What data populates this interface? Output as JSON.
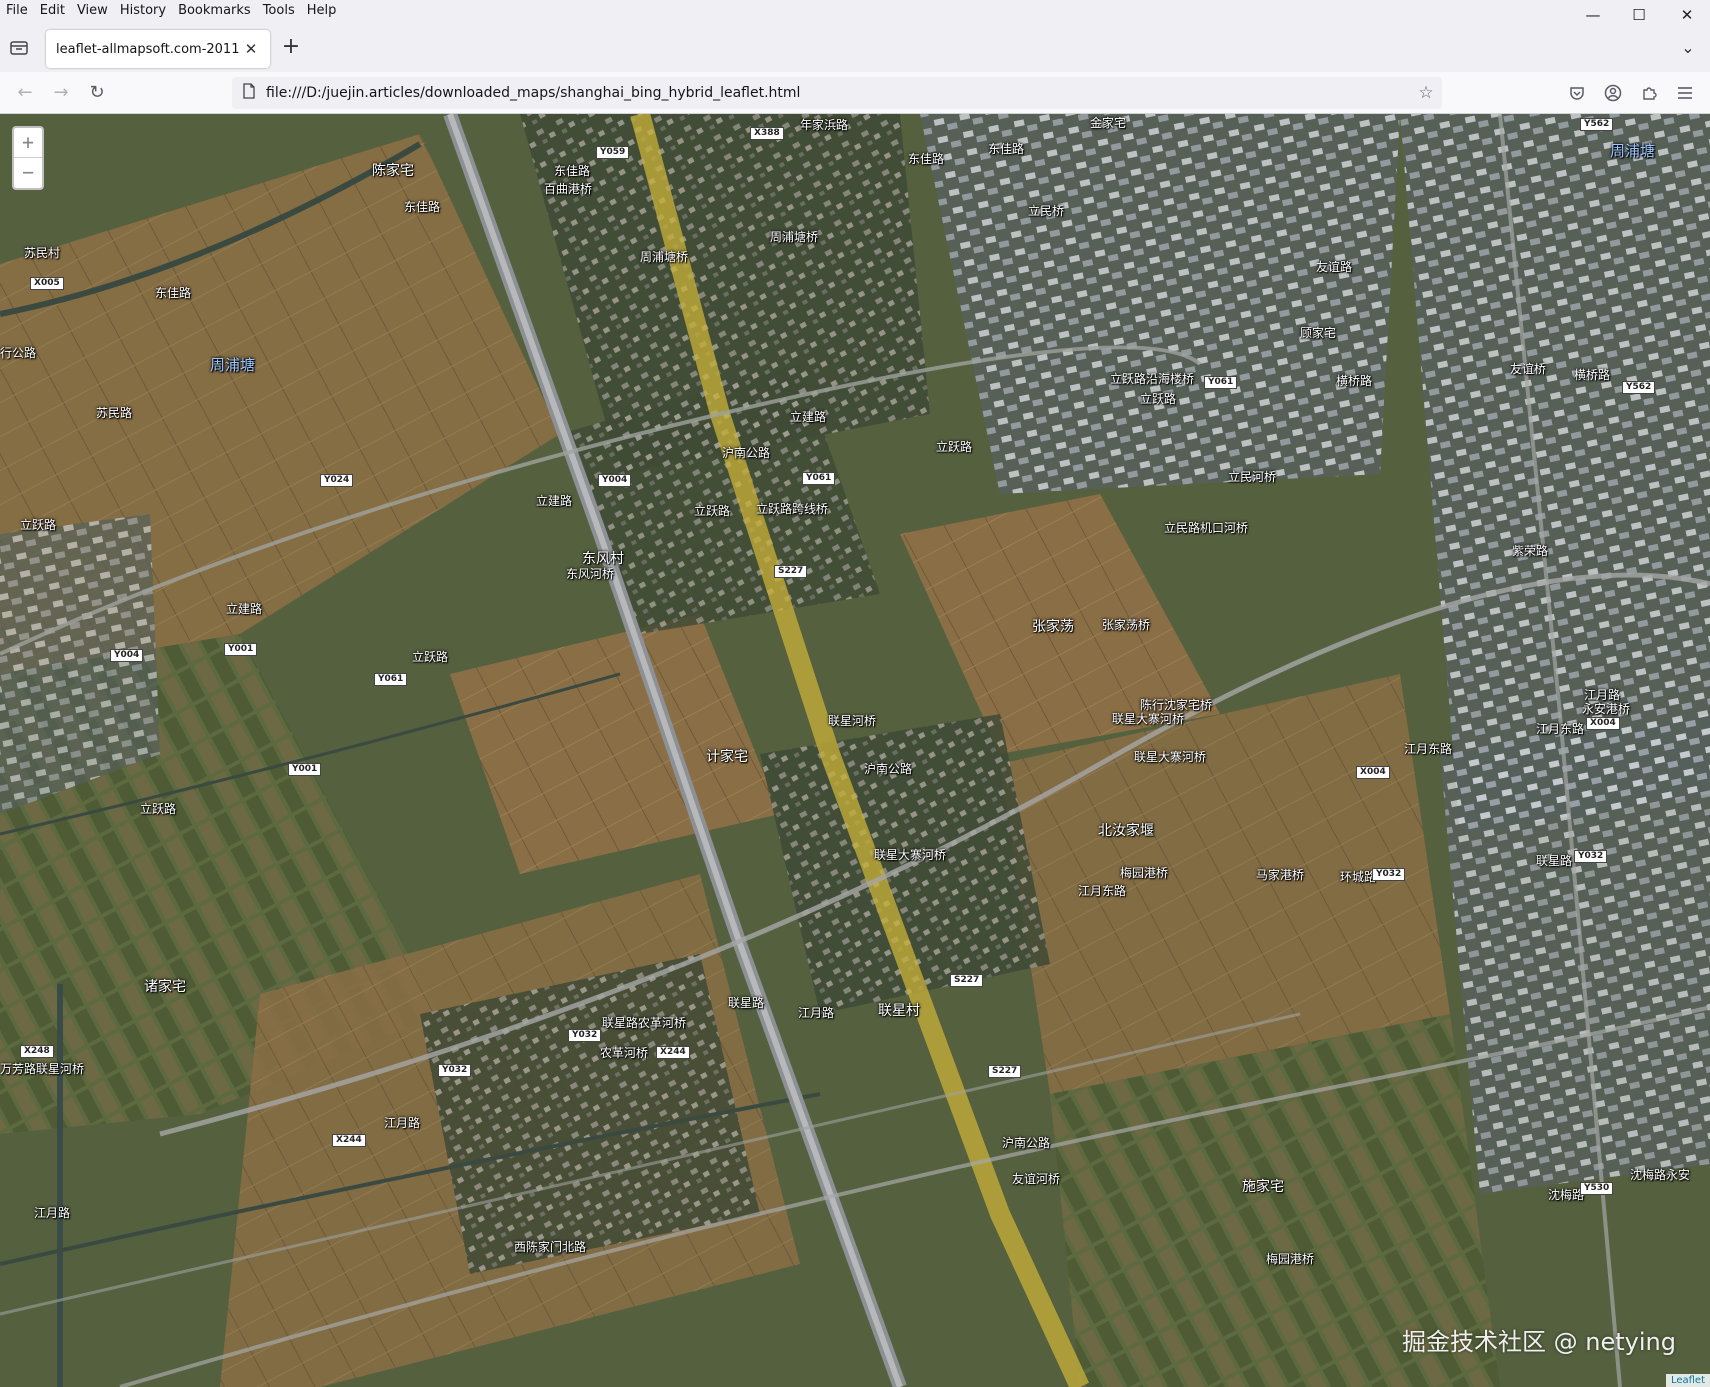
{
  "menu": {
    "items": [
      {
        "label": "File"
      },
      {
        "label": "Edit"
      },
      {
        "label": "View"
      },
      {
        "label": "History"
      },
      {
        "label": "Bookmarks"
      },
      {
        "label": "Tools"
      },
      {
        "label": "Help"
      }
    ]
  },
  "window_controls": {
    "minimize": "—",
    "maximize": "☐",
    "close": "✕"
  },
  "tab": {
    "title": "leaflet-allmapsoft.com-2011",
    "close": "✕"
  },
  "new_tab": "+",
  "tab_overflow": "⌄",
  "nav": {
    "back": "←",
    "forward": "→",
    "reload": "↻"
  },
  "url": "file:///D:/juejin.articles/downloaded_maps/shanghai_bing_hybrid_leaflet.html",
  "url_star": "☆",
  "zoom": {
    "in": "+",
    "out": "−"
  },
  "map_labels": {
    "l1": "金家宅",
    "l2": "年家浜路",
    "l3": "陈家宅",
    "l4": "东佳路",
    "l5": "百曲港桥",
    "l6": "东佳路",
    "l7": "东佳路",
    "l8": "苏民村",
    "l9": "东佳路",
    "l10": "周浦塘",
    "l11": "周浦塘桥",
    "l12": "周浦塘桥",
    "l13": "东佳路",
    "l14": "立民桥",
    "l15": "周浦塘",
    "l16": "顾家宅",
    "l17": "立跃路沿海楼桥",
    "l18": "立跃路",
    "l19": "横桥路",
    "l20": "友谊桥",
    "l21": "横桥路",
    "l22": "立民河桥",
    "l23": "立民路机口河桥",
    "l24": "立跃路",
    "l25": "立跃路跨线桥",
    "l26": "立跃路",
    "l27": "东风村",
    "l28": "东风河桥",
    "l29": "立建路",
    "l30": "立建路",
    "l31": "张家荡",
    "l32": "张家荡桥",
    "l33": "联星河桥",
    "l34": "计家宅",
    "l35": "陈行沈家宅桥",
    "l36": "联星大寨河桥",
    "l37": "联星大寨河桥",
    "l38": "北汝家堰",
    "l39": "梅园港桥",
    "l40": "马家港桥",
    "l41": "江月东路",
    "l42": "江月东路",
    "l43": "江月路",
    "l44": "永安港桥",
    "l45": "联星大寨河桥",
    "l46": "诸家宅",
    "l47": "联星路农革河桥",
    "l48": "农革河桥",
    "l49": "联星村",
    "l50": "江月路",
    "l51": "联星路",
    "l52": "江月路",
    "l53": "江月路",
    "l54": "友谊河桥",
    "l55": "施家宅",
    "l56": "梅园港桥",
    "l57": "沈梅路永安",
    "l58": "沈梅路",
    "l59": "万芳路联星河桥",
    "l60": "立跃路",
    "l61": "立跃路",
    "l62": "立建路",
    "l63": "联星路",
    "l64": "环城路",
    "l65": "苏民路",
    "l66": "立跃路",
    "l67": "沪南公路",
    "l68": "沪南公路",
    "l69": "沪南公路",
    "l70": "西陈家门北路",
    "l71": "行公路",
    "l72": "友谊路",
    "l73": "紫荣路",
    "l74": "江月东路"
  },
  "road_shields": {
    "s1": "Y059",
    "s2": "X388",
    "s3": "X005",
    "s4": "Y024",
    "s5": "Y004",
    "s6": "Y061",
    "s7": "S227",
    "s8": "Y001",
    "s9": "Y004",
    "s10": "Y061",
    "s11": "Y001",
    "s12": "Y562",
    "s13": "Y061",
    "s14": "Y562",
    "s15": "X004",
    "s16": "X004",
    "s17": "Y032",
    "s18": "Y032",
    "s19": "S227",
    "s20": "Y032",
    "s21": "X244",
    "s22": "Y032",
    "s23": "S227",
    "s24": "X248",
    "s25": "X244",
    "s26": "Y530"
  },
  "watermark": "掘金技术社区 @ netying",
  "attribution": "Leaflet"
}
